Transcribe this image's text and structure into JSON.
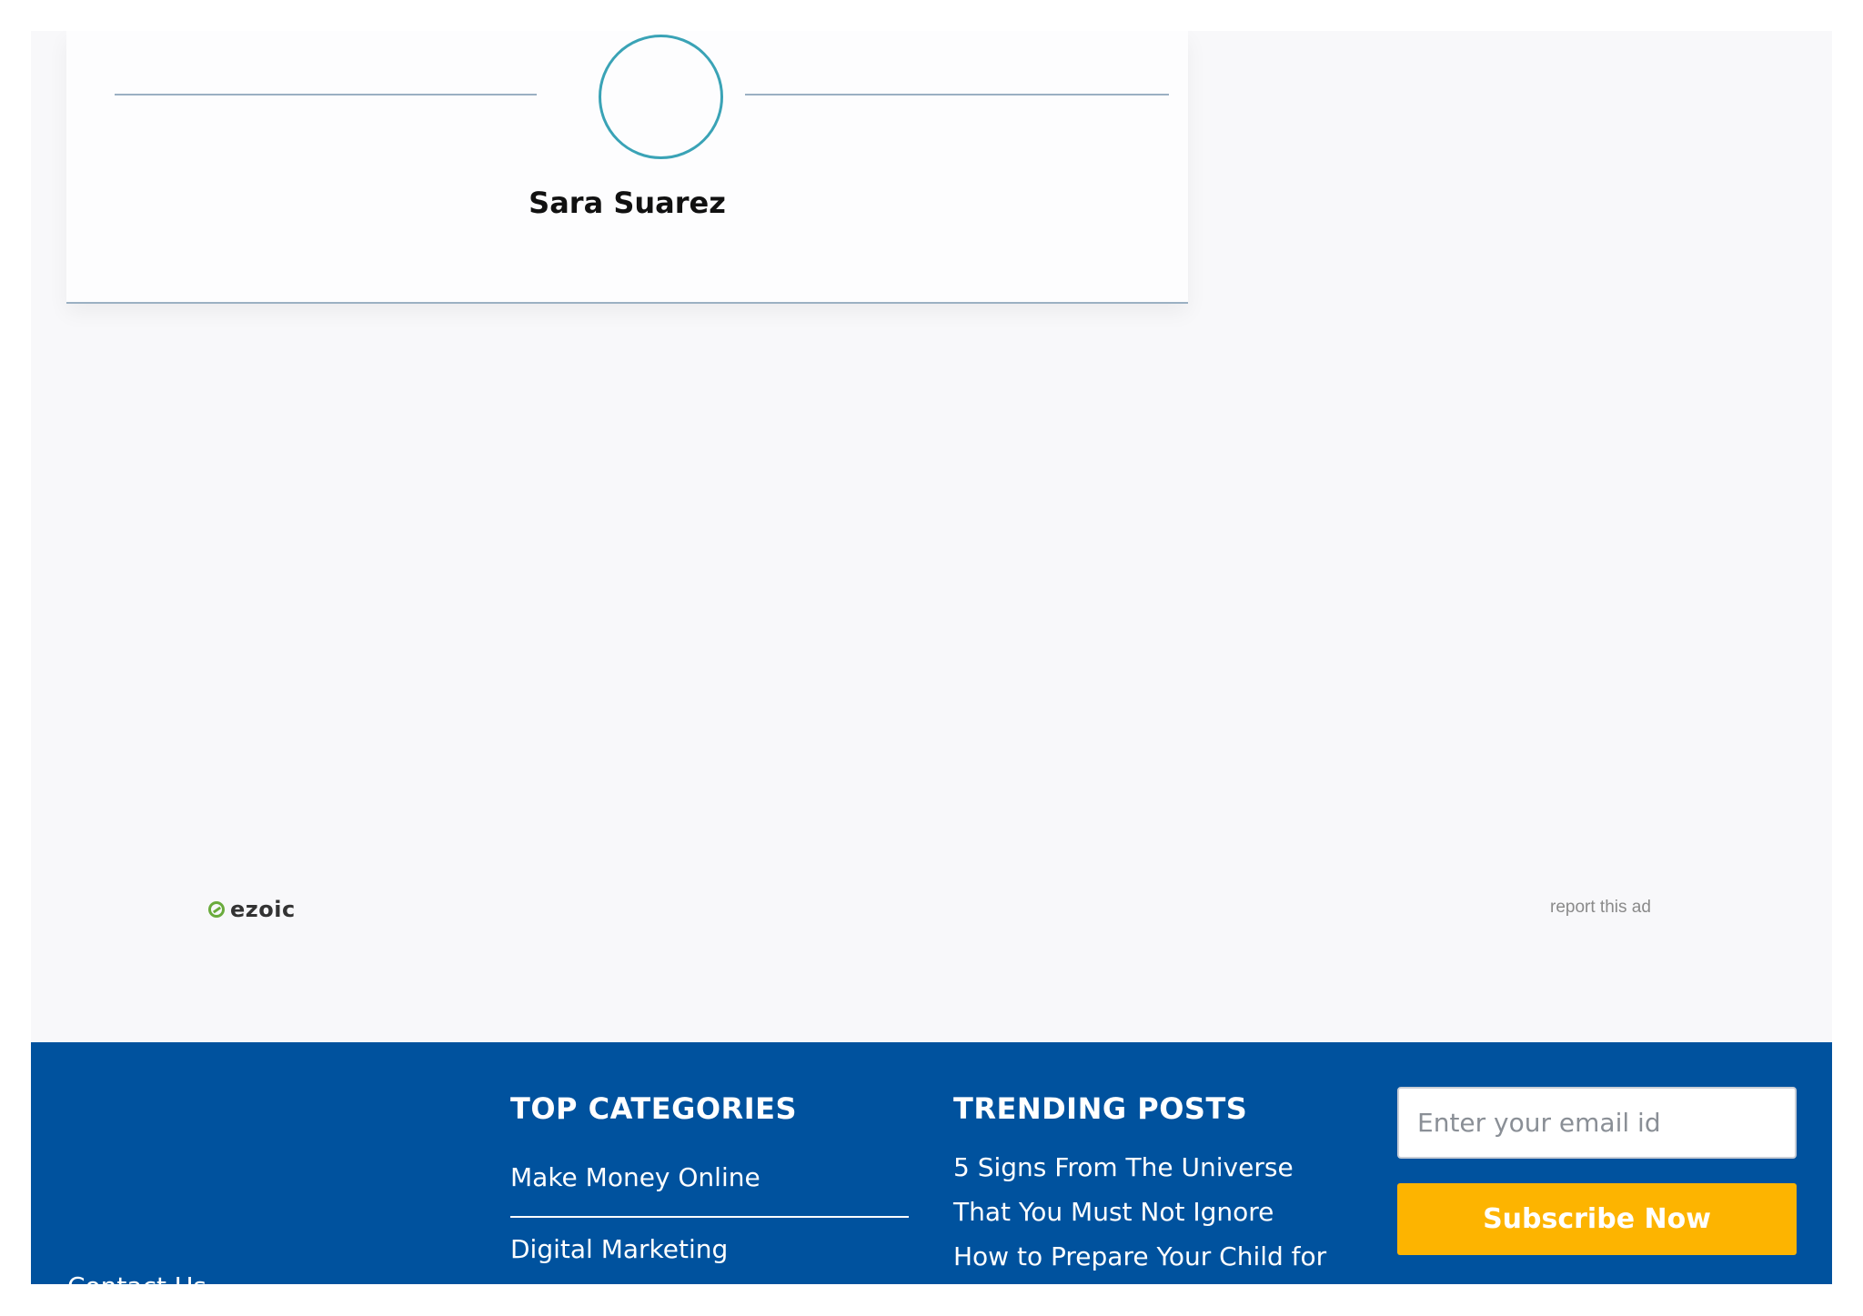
{
  "author": {
    "name": "Sara Suarez"
  },
  "ad": {
    "provider_logo_text": "ezoic",
    "report_label": "report this ad"
  },
  "footer": {
    "contact_label": "Contact Us",
    "top_categories": {
      "heading": "TOP CATEGORIES",
      "items": [
        "Make Money Online",
        "Digital Marketing"
      ]
    },
    "trending_posts": {
      "heading": "TRENDING POSTS",
      "items": [
        "5 Signs From The Universe That You Must Not Ignore",
        "How to Prepare Your Child for"
      ]
    },
    "subscribe": {
      "email_placeholder": "Enter your email id",
      "email_value": "",
      "button_label": "Subscribe Now"
    }
  },
  "colors": {
    "footer_bg": "#00529e",
    "subscribe_button": "#fdb400",
    "avatar_ring": "#3aa3b6",
    "divider": "#9bb0c3"
  },
  "icons": {
    "ezoic_logo": "ezoic-logo-icon"
  }
}
